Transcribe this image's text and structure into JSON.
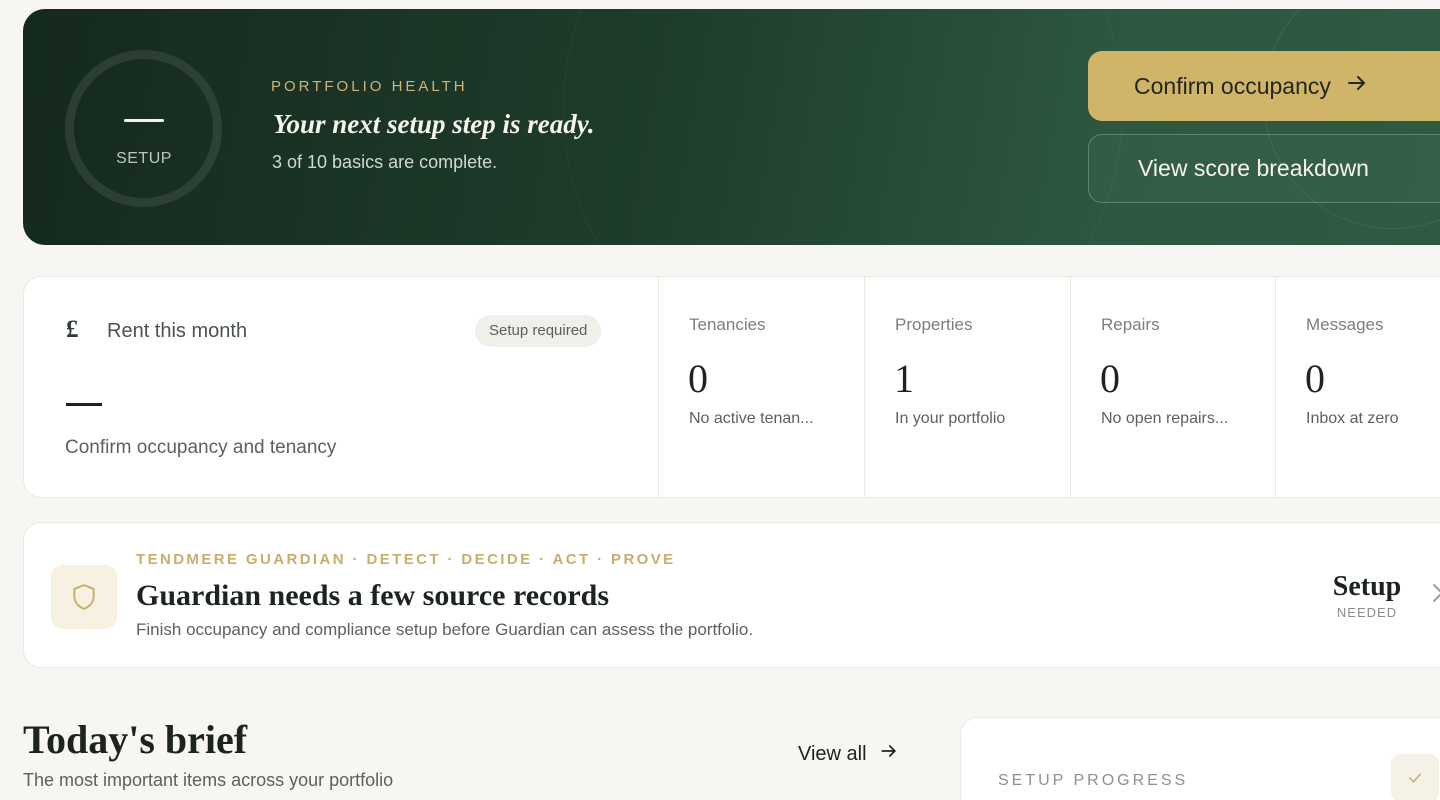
{
  "hero": {
    "score_value": "—",
    "score_label": "SETUP",
    "eyebrow": "PORTFOLIO HEALTH",
    "title": "Your next setup step is ready.",
    "subtitle": "3 of 10 basics are complete.",
    "primary_button": "Confirm occupancy",
    "secondary_button": "View score breakdown"
  },
  "stats": {
    "rent": {
      "label": "Rent this month",
      "badge": "Setup required",
      "value": "—",
      "subtitle": "Confirm occupancy and tenancy"
    },
    "metrics": [
      {
        "label": "Tenancies",
        "value": "0",
        "subtitle": "No active tenan..."
      },
      {
        "label": "Properties",
        "value": "1",
        "subtitle": "In your portfolio"
      },
      {
        "label": "Repairs",
        "value": "0",
        "subtitle": "No open repairs..."
      },
      {
        "label": "Messages",
        "value": "0",
        "subtitle": "Inbox at zero"
      }
    ]
  },
  "guardian": {
    "eyebrow": "TENDMERE GUARDIAN · DETECT · DECIDE · ACT · PROVE",
    "title": "Guardian needs a few source records",
    "subtitle": "Finish occupancy and compliance setup before Guardian can assess the portfolio.",
    "status_main": "Setup",
    "status_sub": "NEEDED"
  },
  "brief": {
    "title": "Today's brief",
    "subtitle": "The most important items across your portfolio",
    "view_all": "View all"
  },
  "progress": {
    "eyebrow": "SETUP PROGRESS"
  },
  "colors": {
    "hero_dark": "#15291e",
    "accent_gold": "#d0b467",
    "background": "#f7f6f2"
  }
}
